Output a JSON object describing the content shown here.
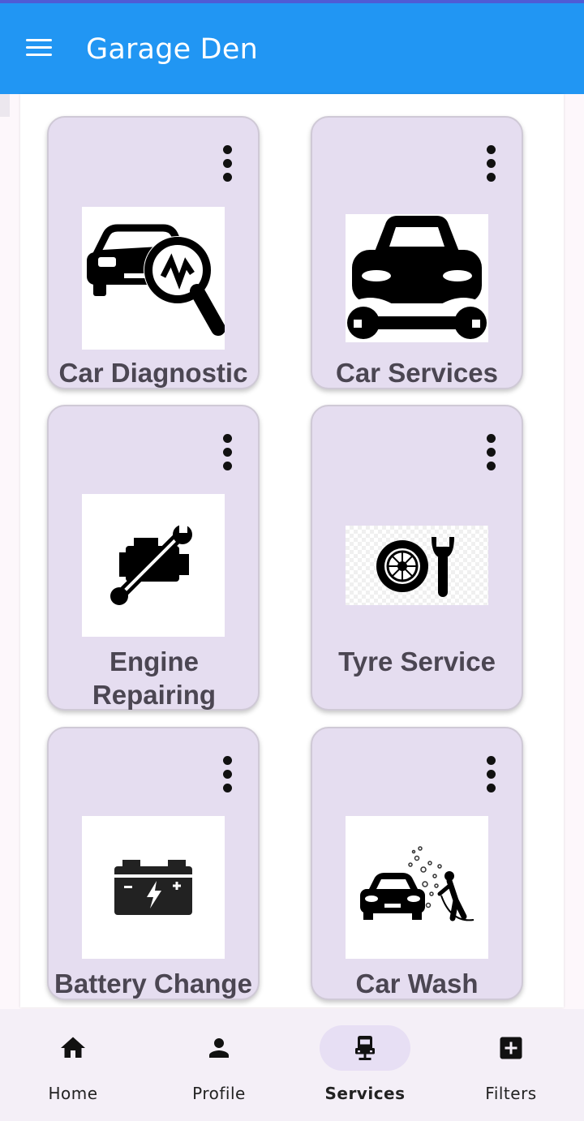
{
  "app": {
    "title": "Garage Den"
  },
  "appbar": {
    "menu_icon": "menu-icon",
    "color": "#2196f3"
  },
  "services": [
    {
      "label": "Car Diagnostic",
      "icon": "car-diagnostic-icon"
    },
    {
      "label": "Car Services",
      "icon": "car-service-icon"
    },
    {
      "label": "Engine Repairing",
      "icon": "engine-repair-icon"
    },
    {
      "label": "Tyre Service",
      "icon": "tyre-service-icon"
    },
    {
      "label": "Battery Change",
      "icon": "battery-icon"
    },
    {
      "label": "Car Wash",
      "icon": "car-wash-icon"
    }
  ],
  "bottom_nav": [
    {
      "label": "Home",
      "icon": "home-icon",
      "active": false
    },
    {
      "label": "Profile",
      "icon": "person-icon",
      "active": false
    },
    {
      "label": "Services",
      "icon": "car-seat-icon",
      "active": true
    },
    {
      "label": "Filters",
      "icon": "add-box-icon",
      "active": false
    }
  ],
  "colors": {
    "card_bg": "#e5ddf0",
    "card_label": "#4b4652",
    "nav_bg": "#f4eff7",
    "nav_active_pill": "#e7dff4"
  }
}
